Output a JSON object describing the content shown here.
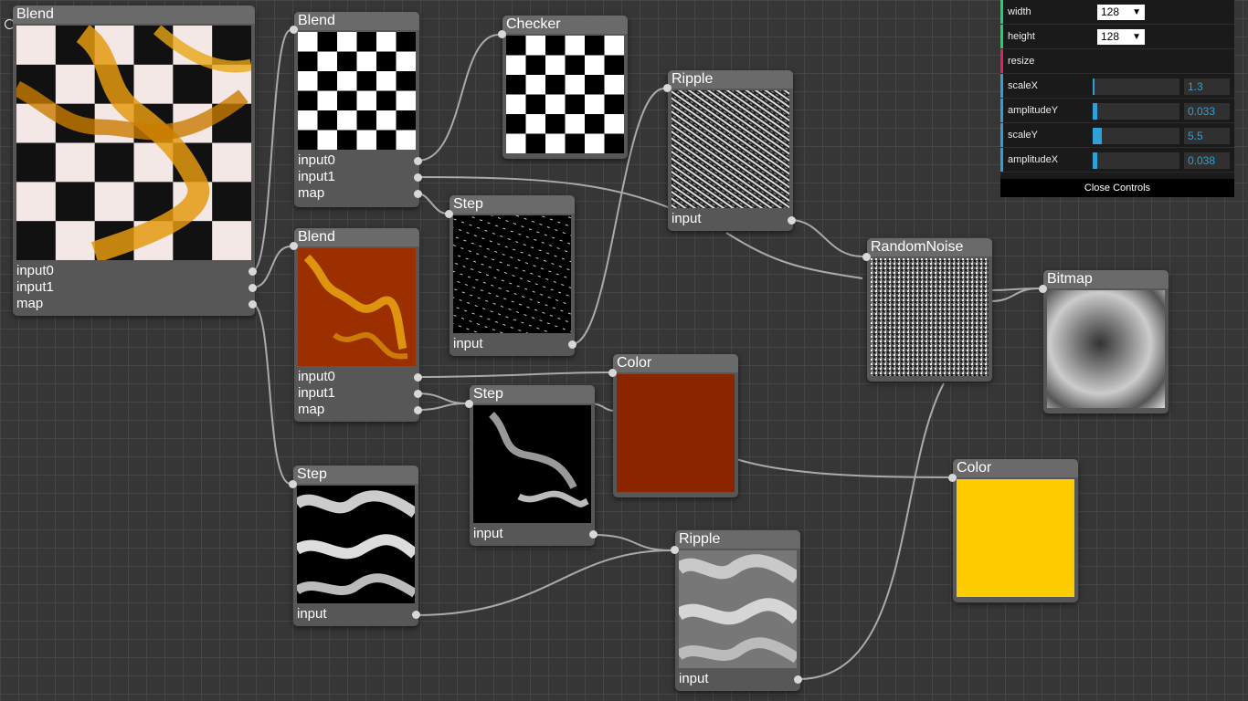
{
  "nodes": {
    "blend_main": {
      "title": "Blend",
      "ports": [
        "input0",
        "input1",
        "map"
      ]
    },
    "blend_top": {
      "title": "Blend",
      "ports": [
        "input0",
        "input1",
        "map"
      ]
    },
    "blend_mid": {
      "title": "Blend",
      "ports": [
        "input0",
        "input1",
        "map"
      ]
    },
    "checker": {
      "title": "Checker"
    },
    "step_top": {
      "title": "Step",
      "ports": [
        "input"
      ]
    },
    "step_mid": {
      "title": "Step",
      "ports": [
        "input"
      ]
    },
    "step_bottom": {
      "title": "Step",
      "ports": [
        "input"
      ]
    },
    "ripple_top": {
      "title": "Ripple",
      "ports": [
        "input"
      ]
    },
    "ripple_bottom": {
      "title": "Ripple",
      "ports": [
        "input"
      ]
    },
    "random_noise": {
      "title": "RandomNoise"
    },
    "bitmap": {
      "title": "Bitmap"
    },
    "color_red": {
      "title": "Color",
      "color": "#8b2500"
    },
    "color_yellow": {
      "title": "Color",
      "color": "#ffcc00"
    }
  },
  "controls": {
    "width": {
      "label": "width",
      "value": "128",
      "accent": "#1ed36f"
    },
    "height": {
      "label": "height",
      "value": "128",
      "accent": "#1ed36f"
    },
    "resize": {
      "label": "resize",
      "accent": "#e61d5f"
    },
    "scaleX": {
      "label": "scaleX",
      "value": "1.3",
      "level": 0.01,
      "accent": "#2fa1d6"
    },
    "amplitudeY": {
      "label": "amplitudeY",
      "value": "0.033",
      "level": 0.05,
      "accent": "#2fa1d6"
    },
    "scaleY": {
      "label": "scaleY",
      "value": "5.5",
      "level": 0.1,
      "accent": "#2fa1d6"
    },
    "amplitudeX": {
      "label": "amplitudeX",
      "value": "0.038",
      "level": 0.05,
      "accent": "#2fa1d6"
    },
    "close_label": "Close Controls"
  }
}
